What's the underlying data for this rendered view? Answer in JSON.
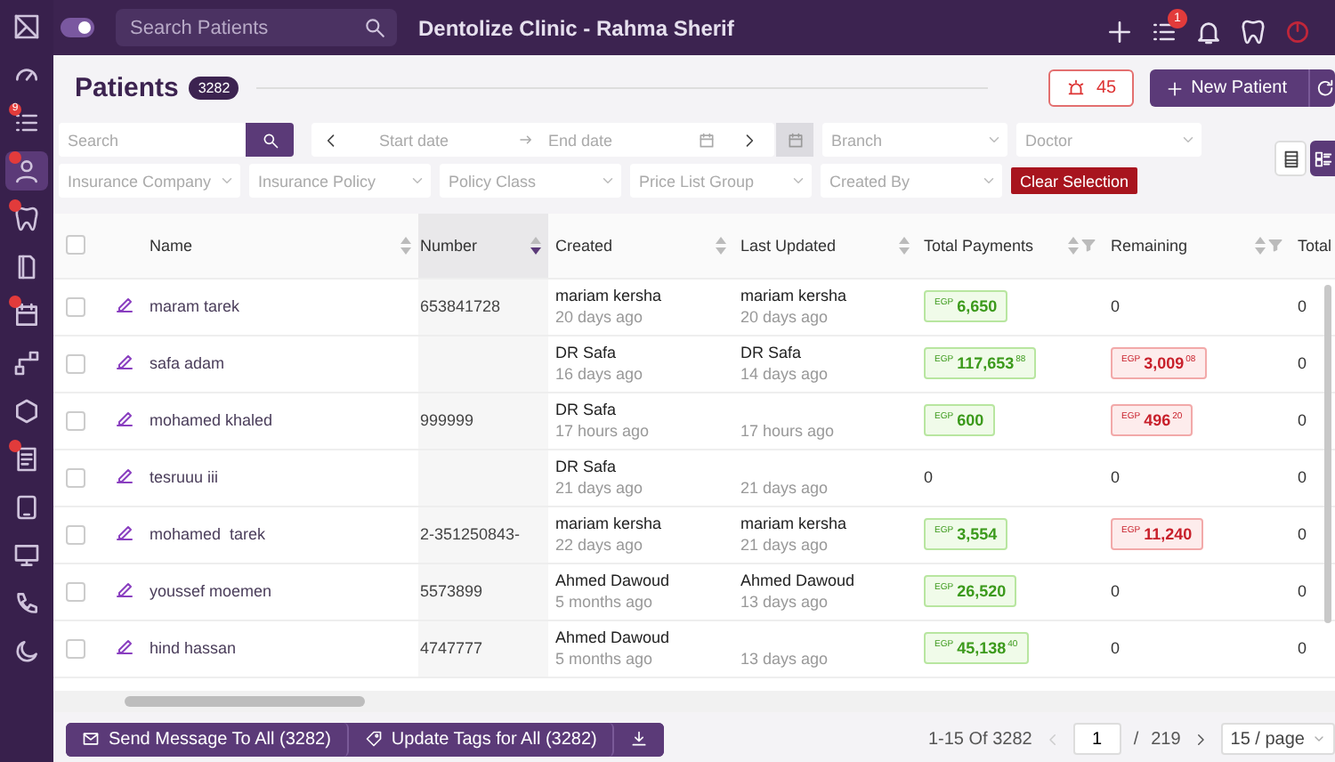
{
  "sidebar": {
    "icons": [
      {
        "kind": "logo",
        "selected": false,
        "badge": false
      },
      {
        "kind": "gauge",
        "selected": false,
        "badge": false
      },
      {
        "kind": "list",
        "selected": false,
        "badge": true,
        "badge_text": "9"
      },
      {
        "kind": "person",
        "selected": true,
        "badge": true
      },
      {
        "kind": "tooth",
        "selected": false,
        "badge": true
      },
      {
        "kind": "page",
        "selected": false,
        "badge": false
      },
      {
        "kind": "calendar",
        "selected": false,
        "badge": true
      },
      {
        "kind": "nodes",
        "selected": false,
        "badge": false
      },
      {
        "kind": "hexagon",
        "selected": false,
        "badge": false
      },
      {
        "kind": "report",
        "selected": false,
        "badge": true
      },
      {
        "kind": "tablet",
        "selected": false,
        "badge": false
      },
      {
        "kind": "monitor",
        "selected": false,
        "badge": false
      },
      {
        "kind": "phone",
        "selected": false,
        "badge": false
      },
      {
        "kind": "moon",
        "selected": false,
        "badge": false
      }
    ]
  },
  "top_bar": {
    "toggle_on": true,
    "search": {
      "placeholder": "Search Patients"
    },
    "title": "Dentolize Clinic - Rahma Sherif",
    "actions": [
      {
        "kind": "plus"
      },
      {
        "kind": "list",
        "badge": "1"
      },
      {
        "kind": "bell"
      },
      {
        "kind": "tooth"
      },
      {
        "kind": "power"
      }
    ]
  },
  "header": {
    "title": "Patients",
    "count": "3282",
    "alarm_count": "45",
    "new_button": "New Patient"
  },
  "filters": {
    "search": {
      "placeholder": "Search"
    },
    "date_range": {
      "start_placeholder": "Start date",
      "end_placeholder": "End date"
    },
    "row_1_selects": [
      {
        "placeholder": "Branch"
      },
      {
        "placeholder": "Doctor"
      }
    ],
    "row_2_selects": [
      {
        "placeholder": "Insurance Company"
      },
      {
        "placeholder": "Insurance Policy"
      },
      {
        "placeholder": "Policy Class"
      },
      {
        "placeholder": "Price List Group"
      },
      {
        "placeholder": "Created By"
      }
    ],
    "clear_button": "Clear Selection",
    "view_buttons": [
      {
        "kind": "table",
        "selected": false
      },
      {
        "kind": "cards",
        "selected": true
      }
    ]
  },
  "table": {
    "select_all_checked": false,
    "columns": [
      {
        "label": "Name",
        "sorted": false,
        "filter": false
      },
      {
        "label": "Number",
        "sorted": true,
        "filter": false
      },
      {
        "label": "Created",
        "sorted": false,
        "filter": false
      },
      {
        "label": "Last Updated",
        "sorted": false,
        "filter": false
      },
      {
        "label": "Total Payments",
        "sorted": false,
        "filter": true
      },
      {
        "label": "Remaining",
        "sorted": false,
        "filter": true
      },
      {
        "label": "Total",
        "sorted": false,
        "filter": false
      }
    ],
    "rows": [
      {
        "checked": false,
        "name": "maram tarek",
        "number": "653841728",
        "created": {
          "by": "mariam kersha",
          "ago": "20 days ago"
        },
        "updated": {
          "by": "mariam kersha",
          "ago": "20 days ago"
        },
        "payments": {
          "kind": "credit",
          "currency": "EGP",
          "amount": "6,650"
        },
        "remaining": {
          "kind": "plain",
          "text": "0"
        },
        "total": "0"
      },
      {
        "checked": false,
        "name": "safa adam",
        "number": "",
        "created": {
          "by": "DR Safa",
          "ago": "16 days ago"
        },
        "updated": {
          "by": "DR Safa",
          "ago": "14 days ago"
        },
        "payments": {
          "kind": "credit",
          "currency": "EGP",
          "amount": "117,653",
          "cents": "88"
        },
        "remaining": {
          "kind": "debit",
          "currency": "EGP",
          "amount": "3,009",
          "cents": "08"
        },
        "total": "0"
      },
      {
        "checked": false,
        "name": "mohamed khaled",
        "number": "999999",
        "created": {
          "by": "DR Safa",
          "ago": "17 hours ago"
        },
        "updated": {
          "ago": "17 hours ago"
        },
        "payments": {
          "kind": "credit",
          "currency": "EGP",
          "amount": "600"
        },
        "remaining": {
          "kind": "debit",
          "currency": "EGP",
          "amount": "496",
          "cents": "20"
        },
        "total": "0"
      },
      {
        "checked": false,
        "name": "tesruuu iii",
        "number": "",
        "created": {
          "by": "DR Safa",
          "ago": "21 days ago"
        },
        "updated": {
          "ago": "21 days ago"
        },
        "payments": {
          "kind": "plain",
          "text": "0"
        },
        "remaining": {
          "kind": "plain",
          "text": "0"
        },
        "total": "0"
      },
      {
        "checked": false,
        "name": "mohamed  tarek",
        "number": "2-351250843-",
        "created": {
          "by": "mariam kersha",
          "ago": "22 days ago"
        },
        "updated": {
          "by": "mariam kersha",
          "ago": "21 days ago"
        },
        "payments": {
          "kind": "credit",
          "currency": "EGP",
          "amount": "3,554"
        },
        "remaining": {
          "kind": "debit",
          "currency": "EGP",
          "amount": "11,240"
        },
        "total": "0"
      },
      {
        "checked": false,
        "name": "youssef moemen",
        "number": "5573899",
        "created": {
          "by": "Ahmed Dawoud",
          "ago": "5 months ago"
        },
        "updated": {
          "by": "Ahmed Dawoud",
          "ago": "13 days ago"
        },
        "payments": {
          "kind": "credit",
          "currency": "EGP",
          "amount": "26,520"
        },
        "remaining": {
          "kind": "plain",
          "text": "0"
        },
        "total": "0"
      },
      {
        "checked": false,
        "name": "hind hassan",
        "number": "4747777",
        "created": {
          "by": "Ahmed Dawoud",
          "ago": "5 months ago"
        },
        "updated": {
          "ago": "13 days ago"
        },
        "payments": {
          "kind": "credit",
          "currency": "EGP",
          "amount": "45,138",
          "cents": "40"
        },
        "remaining": {
          "kind": "plain",
          "text": "0"
        },
        "total": "0"
      }
    ]
  },
  "footer": {
    "buttons": [
      {
        "kind": "message",
        "label": "Send Message To All (3282)"
      },
      {
        "kind": "tag",
        "label": "Update Tags for All (3282)"
      },
      {
        "kind": "download"
      }
    ],
    "pagination": {
      "range": "1-15 Of 3282",
      "page": "1",
      "separator": "/",
      "pages": "219",
      "page_size": "15 / page"
    }
  }
}
